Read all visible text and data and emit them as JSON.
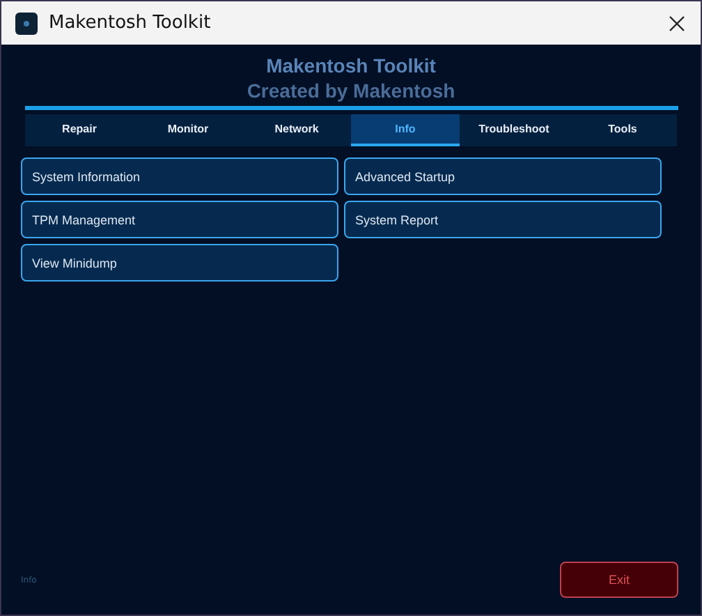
{
  "window": {
    "title": "Makentosh Toolkit"
  },
  "header": {
    "title": "Makentosh Toolkit",
    "subtitle": "Created by Makentosh"
  },
  "tabs": [
    {
      "label": "Repair",
      "selected": false
    },
    {
      "label": "Monitor",
      "selected": false
    },
    {
      "label": "Network",
      "selected": false
    },
    {
      "label": "Info",
      "selected": true
    },
    {
      "label": "Troubleshoot",
      "selected": false
    },
    {
      "label": "Tools",
      "selected": false
    }
  ],
  "actions": [
    "System Information",
    "Advanced Startup",
    "TPM Management",
    "System Report",
    "View Minidump"
  ],
  "status_bar": {
    "text": "Info"
  },
  "exit_button": "Exit"
}
